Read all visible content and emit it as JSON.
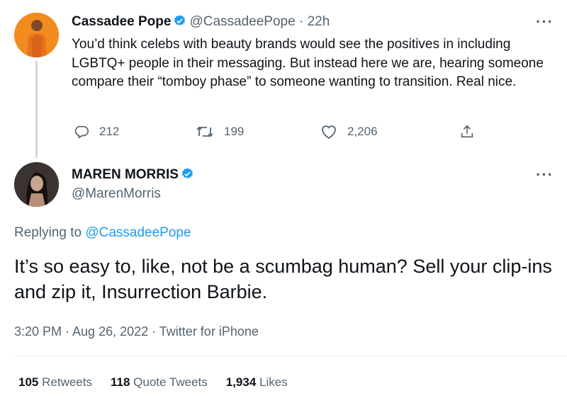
{
  "tweet1": {
    "name": "Cassadee Pope",
    "handle": "@CassadeePope",
    "time": "· 22h",
    "text": "You’d think celebs with beauty brands would see the positives in including LGBTQ+ people in their messaging. But instead here we are, hearing someone compare their “tomboy phase” to someone wanting to transition. Real nice.",
    "replies": "212",
    "retweets": "199",
    "likes": "2,206",
    "more": "···"
  },
  "tweet2": {
    "name": "MAREN MORRIS",
    "handle": "@MarenMorris",
    "more": "···",
    "replying_prefix": "Replying to",
    "replying_to": "@CassadeePope",
    "text": "It’s so easy to, like, not be a scumbag human? Sell your clip-ins and zip it, Insurrection Barbie.",
    "meta": "3:20 PM · Aug 26, 2022 · Twitter for iPhone"
  },
  "stats": {
    "retweets_count": "105",
    "retweets_label": "Retweets",
    "quotes_count": "118",
    "quotes_label": "Quote Tweets",
    "likes_count": "1,934",
    "likes_label": "Likes"
  },
  "colors": {
    "accent": "#1d9bf0",
    "text": "#0f1419",
    "muted": "#536471"
  }
}
